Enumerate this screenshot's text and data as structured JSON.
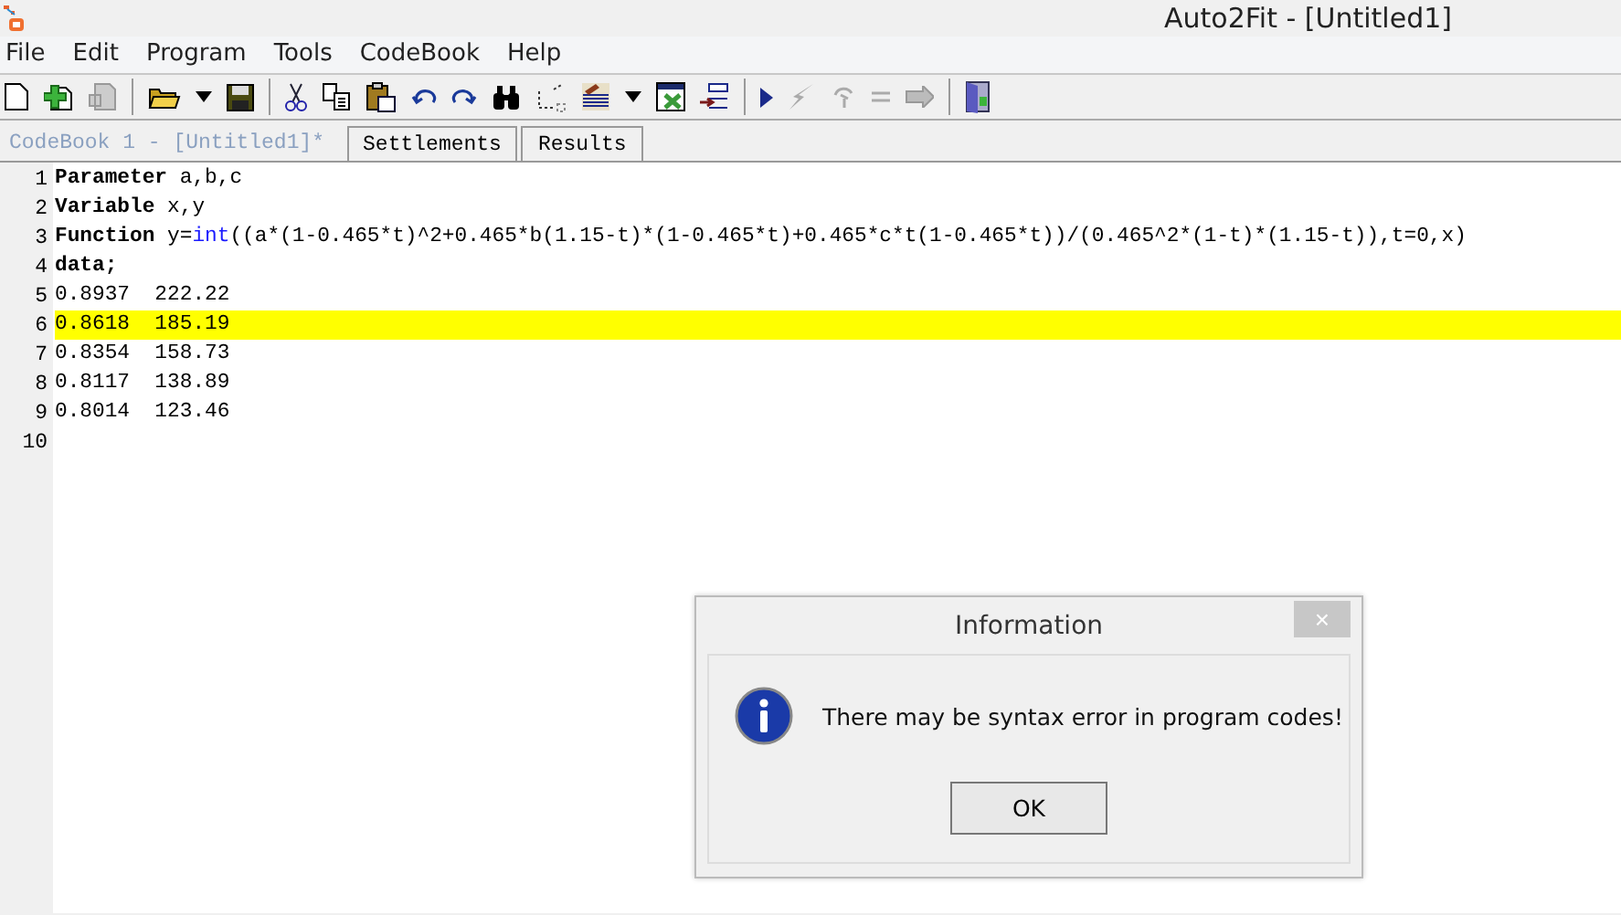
{
  "window": {
    "title": "Auto2Fit - [Untitled1]"
  },
  "menu": [
    "File",
    "Edit",
    "Program",
    "Tools",
    "CodeBook",
    "Help"
  ],
  "tabs": [
    {
      "label": "CodeBook 1 - [Untitled1]*",
      "selected": true
    },
    {
      "label": "Settlements",
      "selected": false
    },
    {
      "label": "Results",
      "selected": false
    }
  ],
  "editor": {
    "lines": [
      {
        "number": "1",
        "highlighted": false,
        "segments": [
          {
            "kind": "keyword",
            "text": "Parameter"
          },
          {
            "kind": "plain",
            "text": " a,b,c"
          }
        ]
      },
      {
        "number": "2",
        "highlighted": false,
        "segments": [
          {
            "kind": "keyword",
            "text": "Variable"
          },
          {
            "kind": "plain",
            "text": " x,y"
          }
        ]
      },
      {
        "number": "3",
        "highlighted": false,
        "segments": [
          {
            "kind": "keyword",
            "text": "Function"
          },
          {
            "kind": "plain",
            "text": " y="
          },
          {
            "kind": "function",
            "text": "int"
          },
          {
            "kind": "plain",
            "text": "((a*(1-0.465*t)^2+0.465*b(1.15-t)*(1-0.465*t)+0.465*c*t(1-0.465*t))/(0.465^2*(1-t)*(1.15-t)),t=0,x)"
          }
        ]
      },
      {
        "number": "4",
        "highlighted": false,
        "segments": [
          {
            "kind": "keyword",
            "text": "data;"
          }
        ]
      },
      {
        "number": "5",
        "highlighted": false,
        "segments": [
          {
            "kind": "plain",
            "text": "0.8937  222.22"
          }
        ]
      },
      {
        "number": "6",
        "highlighted": true,
        "segments": [
          {
            "kind": "plain",
            "text": "0.8618  185.19"
          }
        ]
      },
      {
        "number": "7",
        "highlighted": false,
        "segments": [
          {
            "kind": "plain",
            "text": "0.8354  158.73"
          }
        ]
      },
      {
        "number": "8",
        "highlighted": false,
        "segments": [
          {
            "kind": "plain",
            "text": "0.8117  138.89"
          }
        ]
      },
      {
        "number": "9",
        "highlighted": false,
        "segments": [
          {
            "kind": "plain",
            "text": "0.8014  123.46"
          }
        ]
      },
      {
        "number": "10",
        "highlighted": false
      }
    ]
  },
  "dialog": {
    "title": "Information",
    "close": "×",
    "message": "There may be syntax error in program codes!",
    "button": "OK"
  }
}
